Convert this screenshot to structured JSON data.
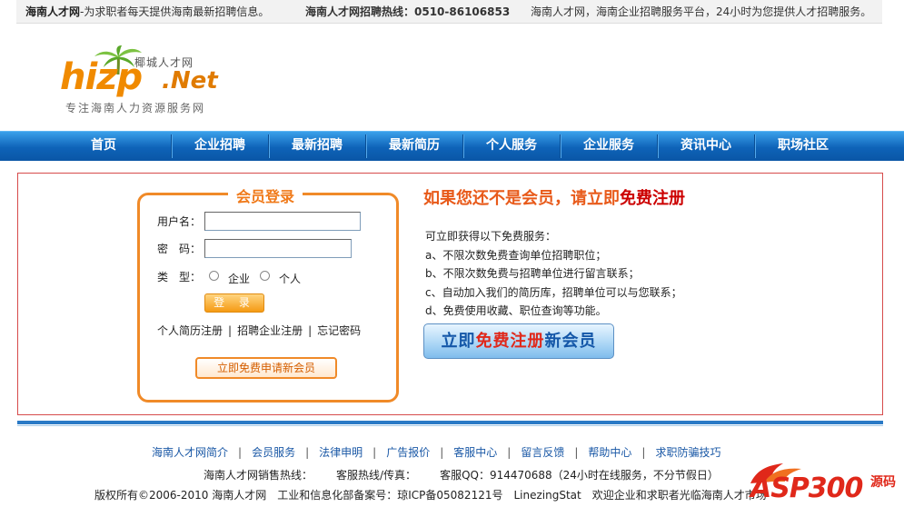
{
  "topbar": {
    "site": "海南人才网",
    "intro": "-为求职者每天提供海南最新招聘信息。",
    "hotline_label": "海南人才网招聘热线：0510-86106853",
    "slogan": "海南人才网，海南企业招聘服务平台，24小时为您提供人才招聘服务。"
  },
  "logo": {
    "word": "hizp",
    "net": ".Net",
    "small_cn": "椰城人才网",
    "tagline": "专注海南人力资源服务网"
  },
  "nav": [
    "首页",
    "企业招聘",
    "最新招聘",
    "最新简历",
    "个人服务",
    "企业服务",
    "资讯中心",
    "职场社区"
  ],
  "login": {
    "title": "会员登录",
    "username_label": "用户名：",
    "password_label": "密　码：",
    "type_label": "类　型：",
    "type_options": [
      "企业",
      "个人"
    ],
    "login_button": "登 录",
    "links": [
      "个人简历注册",
      "招聘企业注册",
      "忘记密码"
    ],
    "apply_button": "立即免费申请新会员"
  },
  "register": {
    "headline_pre": "如果您还不是会员，请立即",
    "headline_hl": "免费注册",
    "intro": "可立即获得以下免费服务：",
    "benefits": [
      "a、不限次数免费查询单位招聘职位；",
      "b、不限次数免费与招聘单位进行留言联系；",
      "c、自动加入我们的简历库，招聘单位可以与您联系；",
      "d、免费使用收藏、职位查询等功能。"
    ],
    "button_pre": "立即",
    "button_hl": "免费注册",
    "button_post": "新会员"
  },
  "footer": {
    "links": [
      "海南人才网简介",
      "会员服务",
      "法律申明",
      "广告报价",
      "客服中心",
      "留言反馈",
      "帮助中心",
      "求职防骗技巧"
    ],
    "sales_hotline": "海南人才网销售热线：",
    "service_hotline": "客服热线/传真：",
    "qq": "客服QQ：914470688（24小时在线服务，不分节假日）",
    "copyright": "版权所有©2006-2010 海南人才网",
    "icp": "工业和信息化部备案号：琼ICP备05082121号",
    "stat": "LinezingStat",
    "welcome": "欢迎企业和求职者光临海南人才市场"
  },
  "watermark": {
    "text": "ASP300",
    "src": "源码",
    "domain": ""
  }
}
